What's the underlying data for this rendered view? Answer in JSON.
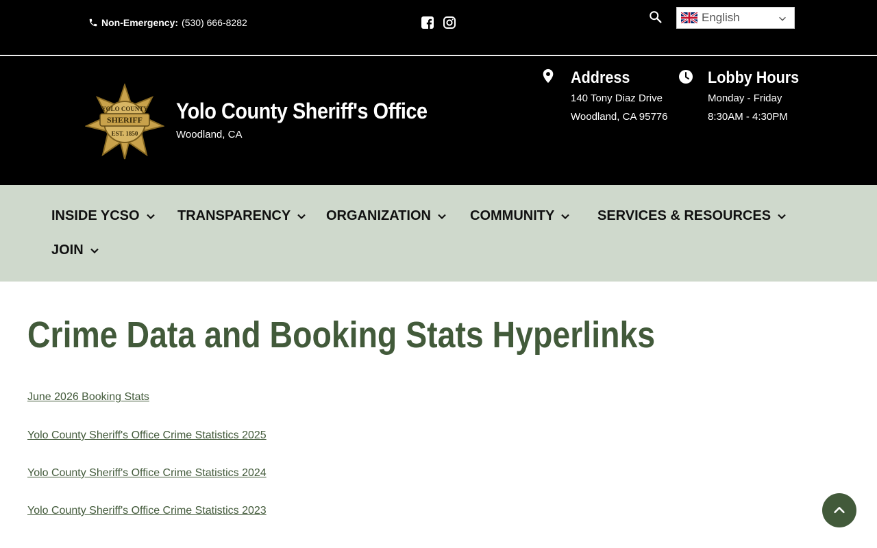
{
  "topbar": {
    "phone_label": "Non-Emergency:",
    "phone_number": "(530) 666-8282",
    "language": "English",
    "icons": [
      "phone-icon",
      "facebook-icon",
      "instagram-icon",
      "search-icon",
      "uk-flag-icon",
      "chevron-down-icon"
    ]
  },
  "header": {
    "title": "Yolo County Sheriff's Office",
    "subtitle": "Woodland, CA",
    "badge": {
      "top": "YOLO COUNTY",
      "center": "SHERIFF",
      "bottom": "EST. 1850"
    },
    "address": {
      "heading": "Address",
      "line1": "140 Tony Diaz Drive",
      "line2": "Woodland, CA 95776"
    },
    "hours": {
      "heading": "Lobby Hours",
      "line1": "Monday - Friday",
      "line2": "8:30AM - 4:30PM"
    }
  },
  "nav": {
    "items": [
      {
        "label": "INSIDE YCSO"
      },
      {
        "label": "TRANSPARENCY"
      },
      {
        "label": "ORGANIZATION"
      },
      {
        "label": "COMMUNITY"
      },
      {
        "label": "SERVICES & RESOURCES"
      },
      {
        "label": "JOIN"
      }
    ]
  },
  "main": {
    "title": "Crime Data and Booking Stats Hyperlinks",
    "links": [
      "June 2026 Booking Stats",
      "Yolo County Sheriff's Office Crime Statistics 2025",
      "Yolo County Sheriff's Office Crime Statistics 2024",
      "Yolo County Sheriff's Office Crime Statistics 2023"
    ]
  },
  "colors": {
    "accent": "#425a3a",
    "nav_bg": "#cfd9cc",
    "header_bg": "#000000"
  }
}
